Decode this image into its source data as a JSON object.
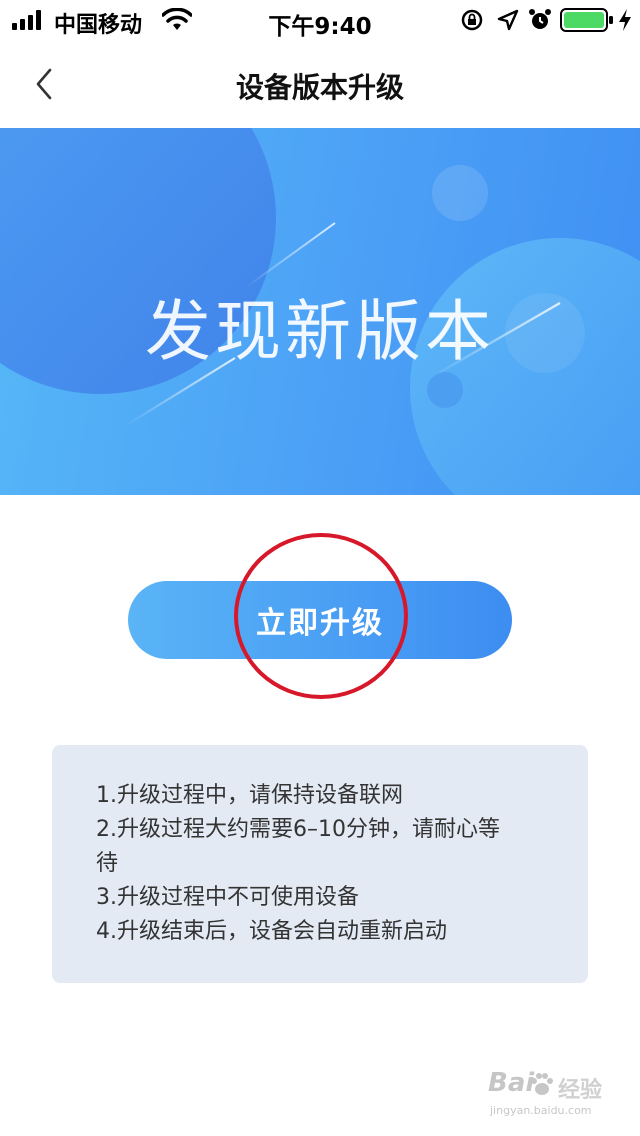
{
  "status_bar": {
    "carrier": "中国移动",
    "time": "下午9:40",
    "battery_color": "#4cd964"
  },
  "nav": {
    "title": "设备版本升级"
  },
  "banner": {
    "title": "发现新版本"
  },
  "upgrade_button": {
    "label": "立即升级"
  },
  "notes": [
    "1.升级过程中，请保持设备联网",
    "2.升级过程大约需要6–10分钟，请耐心等",
    "待",
    "3.升级过程中不可使用设备",
    "4.升级结束后，设备会自动重新启动"
  ],
  "watermark": {
    "logo": "Bai",
    "brand": "经验",
    "url": "jingyan.baidu.com"
  },
  "colors": {
    "accent": "#4a9cf5",
    "highlight": "#d7182a"
  }
}
